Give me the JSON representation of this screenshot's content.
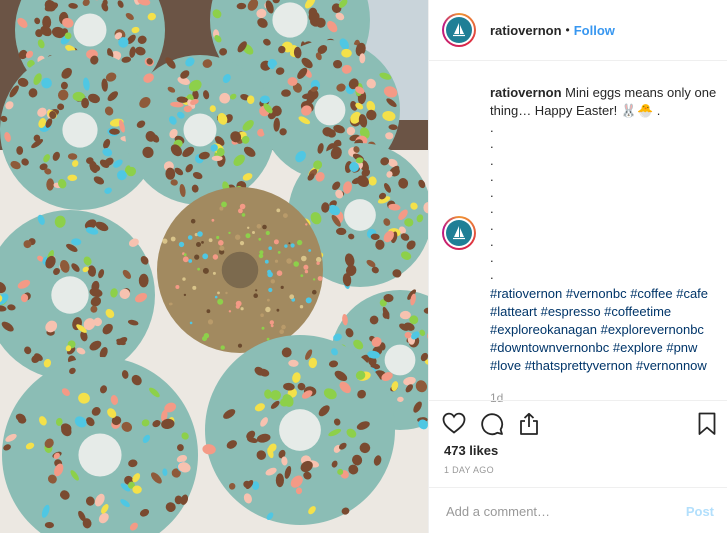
{
  "post": {
    "username": "ratiovernon",
    "separator": "•",
    "follow_label": "Follow",
    "caption_user": "ratiovernon",
    "caption_text": "Mini eggs means only one thing… Happy Easter! 🐰🐣 .",
    "caption_dots": [
      ".",
      ".",
      ".",
      ".",
      ".",
      ".",
      ".",
      ".",
      ".",
      "."
    ],
    "hashtags": "#ratiovernon #vernonbc #coffee #cafe #latteart #espresso #coffeetime #exploreokanagan #explorevernonbc #downtownvernonbc #explore #pnw #love #thatsprettyvernon #vernonnow",
    "caption_age": "1d",
    "likes": "473 likes",
    "timestamp": "1 DAY AGO",
    "comment_placeholder": "Add a comment…",
    "post_label": "Post"
  },
  "icons": {
    "like": "heart-icon",
    "comment": "comment-icon",
    "share": "share-icon",
    "save": "bookmark-icon",
    "avatar": "sailboat-logo-icon"
  },
  "colors": {
    "link_blue": "#3897f0",
    "hashtag": "#003569",
    "avatar_bg": "#1f7f96",
    "post_disabled": "#b2dffc",
    "icing": "#8bbdb5"
  }
}
